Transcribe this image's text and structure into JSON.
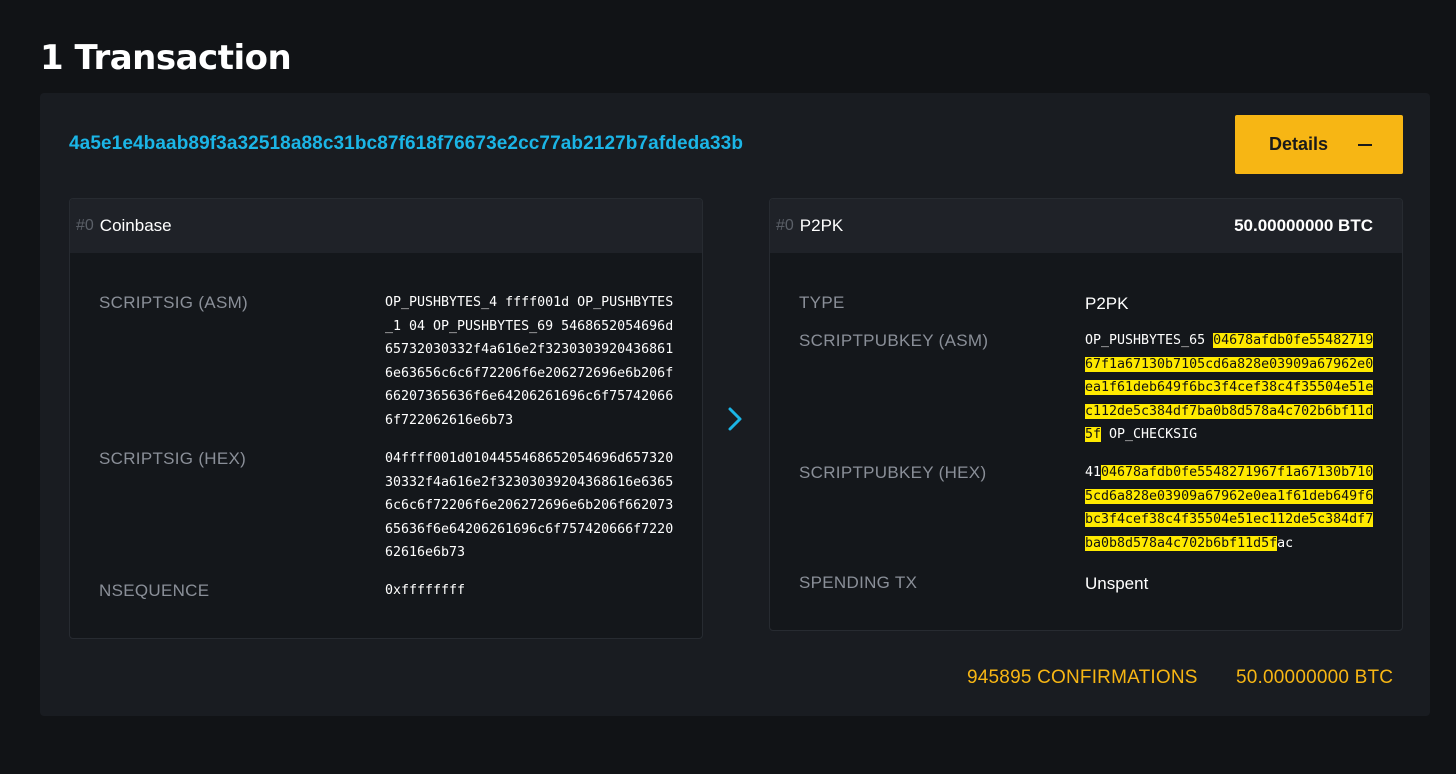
{
  "page": {
    "title": "1 Transaction"
  },
  "transaction": {
    "txid": "4a5e1e4baab89f3a32518a88c31bc87f618f76673e2cc77ab2127b7afdeda33b",
    "details_label": "Details",
    "input": {
      "index": "#0",
      "type": "Coinbase",
      "scriptsig_asm_label": "SCRIPTSIG (ASM)",
      "scriptsig_asm": "OP_PUSHBYTES_4 ffff001d OP_PUSHBYTES_1 04 OP_PUSHBYTES_69 5468652054696d65732030332f4a616e2f32303039204368616e63656c6c6f72206f6e206272696e6b206f66207365636f6e64206261696c6f757420666f722062616e6b73",
      "scriptsig_hex_label": "SCRIPTSIG (HEX)",
      "scriptsig_hex": "04ffff001d0104455468652054696d65732030332f4a616e2f32303039204368616e63656c6c6f72206f6e206272696e6b206f66207365636f6e64206261696c6f757420666f722062616e6b73",
      "nsequence_label": "NSEQUENCE",
      "nsequence": "0xffffffff"
    },
    "output": {
      "index": "#0",
      "type": "P2PK",
      "amount": "50.00000000 BTC",
      "type_label": "TYPE",
      "type_value": "P2PK",
      "scriptpubkey_asm_label": "SCRIPTPUBKEY (ASM)",
      "scriptpubkey_asm_prefix": "OP_PUSHBYTES_65",
      "pubkey": "04678afdb0fe5548271967f1a67130b7105cd6a828e03909a67962e0ea1f61deb649f6bc3f4cef38c4f35504e51ec112de5c384df7ba0b8d578a4c702b6bf11d5f",
      "scriptpubkey_asm_suffix": "OP_CHECKSIG",
      "scriptpubkey_hex_label": "SCRIPTPUBKEY (HEX)",
      "scriptpubkey_hex_prefix": "41",
      "scriptpubkey_hex_suffix": "ac",
      "spending_tx_label": "SPENDING TX",
      "spending_tx": "Unspent"
    },
    "confirmations": "945895 CONFIRMATIONS",
    "total": "50.00000000 BTC"
  },
  "colors": {
    "accent": "#f7b614",
    "link": "#1bb5e6",
    "highlight": "#ffea00"
  },
  "icons": {
    "arrow": "chevron-right-icon",
    "collapse": "minus-icon"
  }
}
